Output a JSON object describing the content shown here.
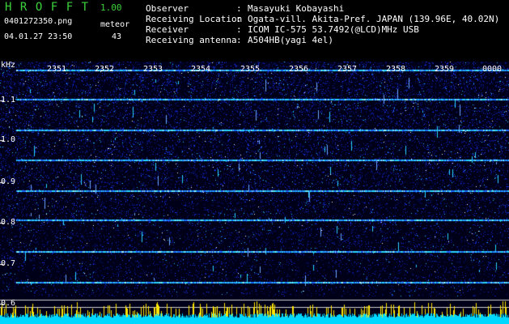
{
  "header": {
    "app_title": "HROFFT",
    "app_version": "1.00",
    "filename": "0401272350.png",
    "mode": "meteor",
    "datetime": "04.01.27 23:50",
    "count": "43",
    "observer_label": "Observer",
    "observer_value": "Masayuki Kobayashi",
    "location_label": "Receiving Location",
    "location_value": "Ogata-vill. Akita-Pref. JAPAN (139.96E, 40.02N)",
    "receiver_label": "Receiver",
    "receiver_value": "ICOM IC-575 53.7492(@LCD)MHz USB",
    "antenna_label": "Receiving antenna",
    "antenna_value": "A504HB(yagi 4el)",
    "sep": ":"
  },
  "spectrogram": {
    "unit": "kHz",
    "y_labels": [
      "1.1",
      "1.0",
      "0.9",
      "0.8",
      "0.7",
      "0.6"
    ],
    "time_labels": [
      "2351",
      "2352",
      "2353",
      "2354",
      "2355",
      "2356",
      "2357",
      "2358",
      "2359",
      "0000"
    ],
    "colors": {
      "text": "#ffffff",
      "title": "#3bd23b",
      "signal": "#00e5ff",
      "level": "#ffe600"
    }
  }
}
